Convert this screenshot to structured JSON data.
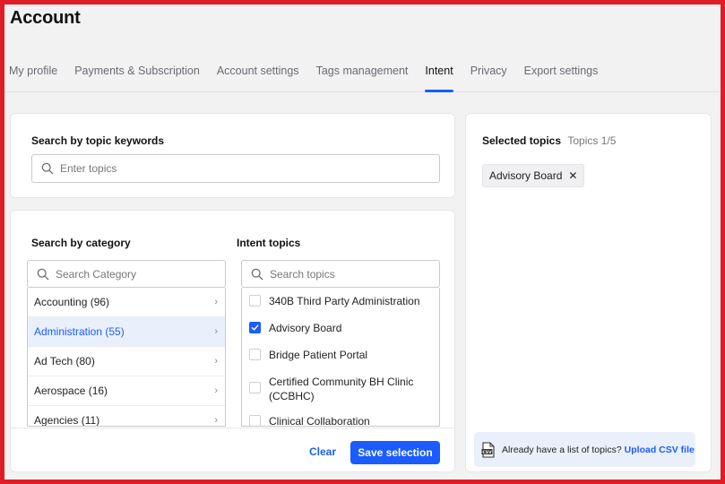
{
  "page": {
    "title": "Account"
  },
  "tabs": [
    {
      "label": "My profile"
    },
    {
      "label": "Payments & Subscription"
    },
    {
      "label": "Account settings"
    },
    {
      "label": "Tags management"
    },
    {
      "label": "Intent",
      "active": true
    },
    {
      "label": "Privacy"
    },
    {
      "label": "Export settings"
    }
  ],
  "keyword_search": {
    "label": "Search by topic keywords",
    "placeholder": "Enter topics"
  },
  "category": {
    "label": "Search by category",
    "placeholder": "Search Category",
    "items": [
      {
        "label": "Accounting (96)"
      },
      {
        "label": "Administration (55)",
        "active": true
      },
      {
        "label": "Ad Tech (80)"
      },
      {
        "label": "Aerospace (16)"
      },
      {
        "label": "Agencies (11)"
      }
    ]
  },
  "topics": {
    "label": "Intent topics",
    "placeholder": "Search topics",
    "items": [
      {
        "label": "340B Third Party Administration",
        "checked": false
      },
      {
        "label": "Advisory Board",
        "checked": true
      },
      {
        "label": "Bridge Patient Portal",
        "checked": false
      },
      {
        "label": "Certified Community BH Clinic (CCBHC)",
        "checked": false
      },
      {
        "label": "Clinical Collaboration",
        "checked": false
      }
    ]
  },
  "actions": {
    "clear": "Clear",
    "save": "Save selection"
  },
  "selected": {
    "title": "Selected topics",
    "count": "Topics 1/5",
    "chips": [
      {
        "label": "Advisory Board",
        "remove": "✕"
      }
    ]
  },
  "csv": {
    "text": "Already have a list of topics?",
    "link": "Upload CSV file"
  },
  "colors": {
    "accent": "#1a5cff",
    "frame": "#e01c24",
    "active_bg": "#eaf0fb"
  }
}
